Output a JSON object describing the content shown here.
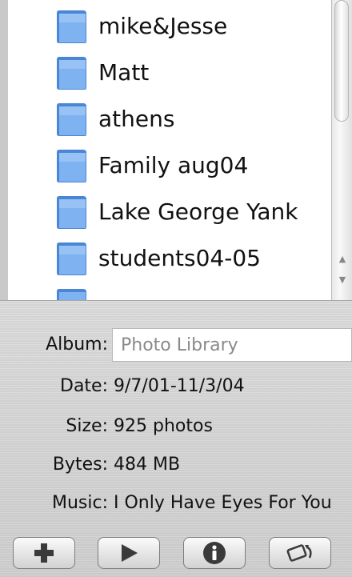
{
  "albums": [
    {
      "label": "mike&Jesse",
      "icon": "folder-icon"
    },
    {
      "label": "Matt",
      "icon": "folder-icon"
    },
    {
      "label": "athens",
      "icon": "folder-icon"
    },
    {
      "label": "Family aug04",
      "icon": "folder-icon"
    },
    {
      "label": "Lake George Yank",
      "icon": "folder-icon"
    },
    {
      "label": "students04-05",
      "icon": "folder-icon"
    }
  ],
  "info": {
    "album_label": "Album:",
    "album_placeholder": "Photo Library",
    "date_label": "Date:",
    "date_value": "9/7/01-11/3/04",
    "size_label": "Size:",
    "size_value": "925 photos",
    "bytes_label": "Bytes:",
    "bytes_value": "484 MB",
    "music_label": "Music:",
    "music_value": "I Only Have Eyes For You"
  },
  "toolbar": {
    "buttons": [
      "add-icon",
      "play-icon",
      "info-icon",
      "rotate-icon"
    ]
  },
  "colors": {
    "folder_blue": "#5b9be6",
    "panel_bg": "#d6d6d6"
  }
}
